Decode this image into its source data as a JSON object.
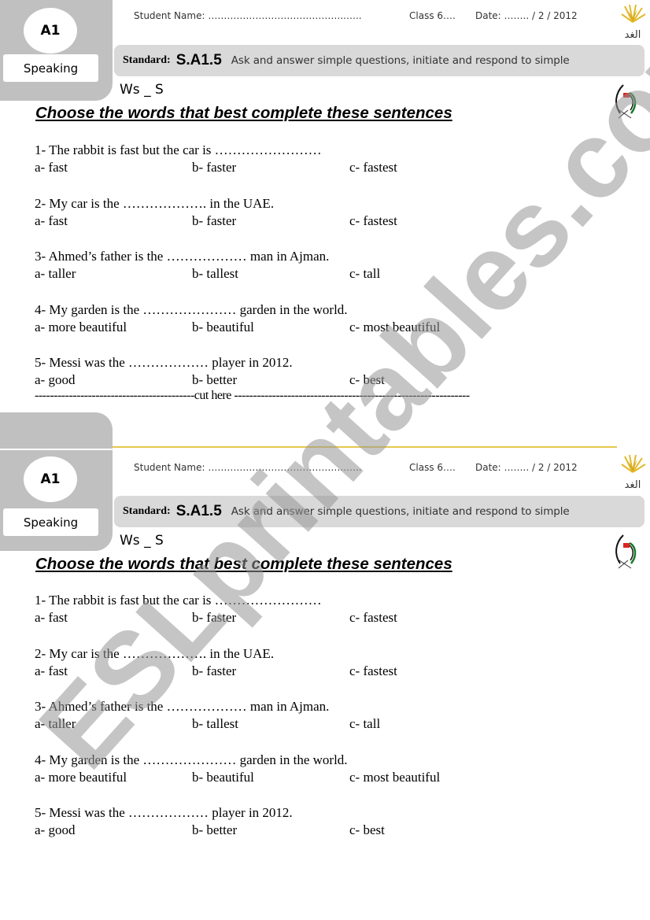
{
  "header": {
    "level": "A1",
    "skill": "Speaking",
    "student_name": "Student Name: ……………………………………..…..",
    "class": "Class  6….",
    "date": "Date: …….. / 2 / 2012",
    "standard_label": "Standard:",
    "standard_code": "S.A1.5",
    "standard_desc": "Ask and answer simple questions, initiate and respond to simple",
    "ws_code": "Ws _ S",
    "instructions": "Choose the words that best complete these sentences"
  },
  "logos": {
    "top": "al-ghad-schools-logo",
    "bottom": "uae-flag-emblem-logo"
  },
  "questions": [
    {
      "text": "1- The rabbit is fast but the car is ……………………",
      "options": [
        "a- fast",
        "b- faster",
        "c- fastest"
      ]
    },
    {
      "text": "2- My car is the ………………. in the UAE.",
      "options": [
        "a- fast",
        "b- faster",
        "c- fastest"
      ]
    },
    {
      "text": "3- Ahmed’s father is the ……………… man in Ajman.",
      "options": [
        "a- taller",
        "b- tallest",
        "c- tall"
      ]
    },
    {
      "text": "4- My garden is the  ………………… garden in the world.",
      "options": [
        "a- more beautiful",
        "b- beautiful",
        "c- most beautiful"
      ]
    },
    {
      "text": "5- Messi was the ……………… player in 2012.",
      "options": [
        "a- good",
        "b- better",
        "c- best"
      ]
    }
  ],
  "cut_line": "------------------------------------------cut here --------------------------------------------------------------",
  "watermark": "ESLprintables.com",
  "colors": {
    "tab_grey": "#c0c0c0",
    "standard_bar": "#d9d9d9",
    "gold_line": "#e6c84c"
  }
}
